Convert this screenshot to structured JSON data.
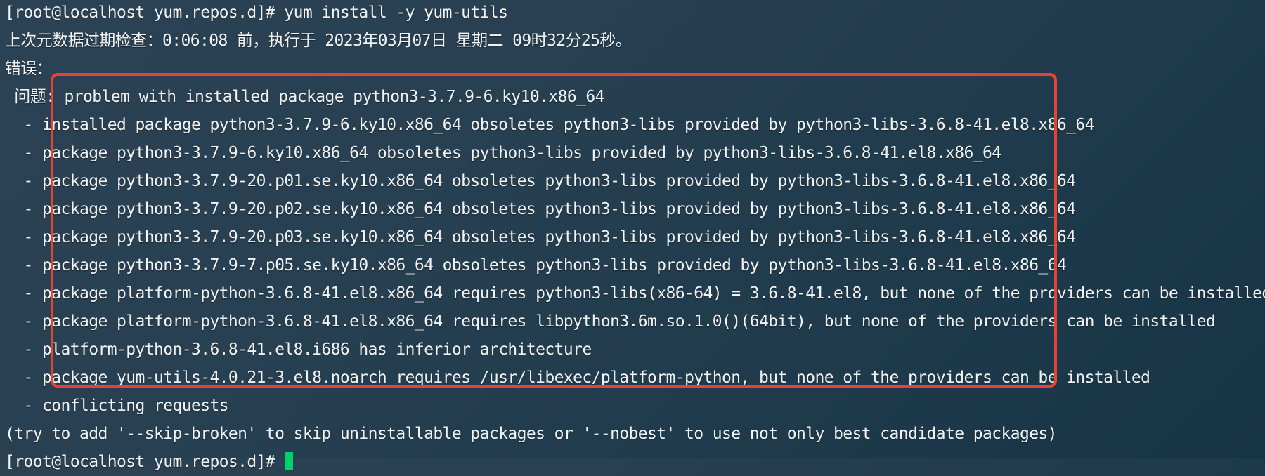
{
  "terminal": {
    "lines": [
      "[root@localhost yum.repos.d]# yum install -y yum-utils",
      "上次元数据过期检查：0:06:08 前，执行于 2023年03月07日 星期二 09时32分25秒。",
      "错误：",
      " 问题: problem with installed package python3-3.7.9-6.ky10.x86_64",
      "  - installed package python3-3.7.9-6.ky10.x86_64 obsoletes python3-libs provided by python3-libs-3.6.8-41.el8.x86_64",
      "  - package python3-3.7.9-6.ky10.x86_64 obsoletes python3-libs provided by python3-libs-3.6.8-41.el8.x86_64",
      "  - package python3-3.7.9-20.p01.se.ky10.x86_64 obsoletes python3-libs provided by python3-libs-3.6.8-41.el8.x86_64",
      "  - package python3-3.7.9-20.p02.se.ky10.x86_64 obsoletes python3-libs provided by python3-libs-3.6.8-41.el8.x86_64",
      "  - package python3-3.7.9-20.p03.se.ky10.x86_64 obsoletes python3-libs provided by python3-libs-3.6.8-41.el8.x86_64",
      "  - package python3-3.7.9-7.p05.se.ky10.x86_64 obsoletes python3-libs provided by python3-libs-3.6.8-41.el8.x86_64",
      "  - package platform-python-3.6.8-41.el8.x86_64 requires python3-libs(x86-64) = 3.6.8-41.el8, but none of the providers can be installed",
      "  - package platform-python-3.6.8-41.el8.x86_64 requires libpython3.6m.so.1.0()(64bit), but none of the providers can be installed",
      "  - platform-python-3.6.8-41.el8.i686 has inferior architecture",
      "  - package yum-utils-4.0.21-3.el8.noarch requires /usr/libexec/platform-python, but none of the providers can be installed",
      "  - conflicting requests",
      "(try to add '--skip-broken' to skip uninstallable packages or '--nobest' to use not only best candidate packages)",
      "[root@localhost yum.repos.d]# "
    ]
  },
  "colors": {
    "background": "#22394a",
    "text": "#f2f4f5",
    "cursor": "#00d26a",
    "highlight_box": "#e7432f"
  }
}
